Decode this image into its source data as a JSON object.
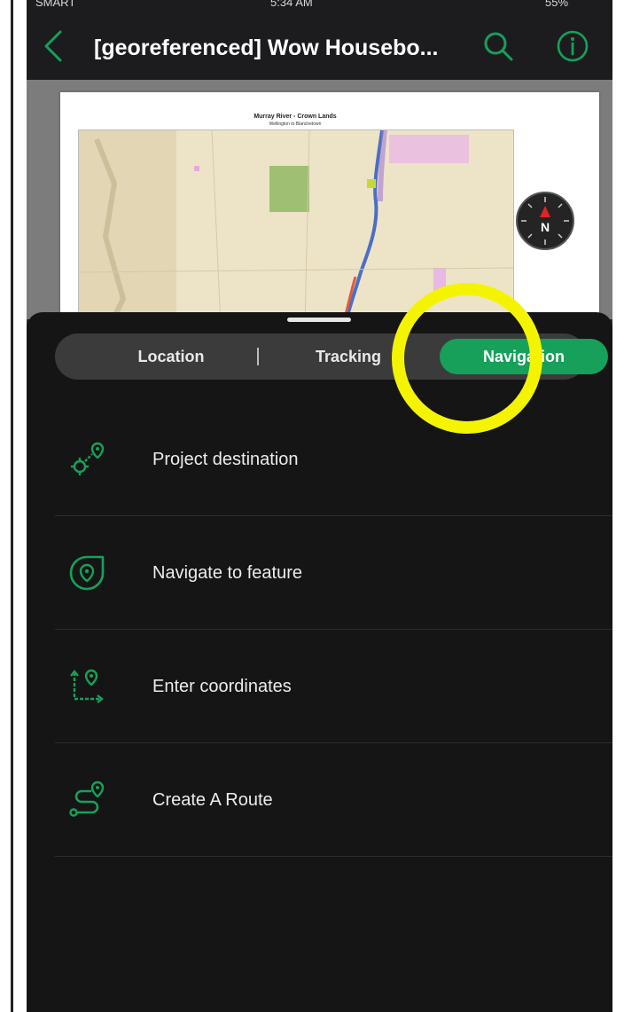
{
  "status_bar": {
    "carrier": "SMART",
    "time": "5:34 AM",
    "battery": "55%"
  },
  "header": {
    "title": "[georeferenced] Wow Housebo...",
    "back_icon": "chevron-left-icon",
    "search_icon": "search-icon",
    "info_icon": "info-icon"
  },
  "map": {
    "title": "Murray River - Crown Lands",
    "subtitle": "Wellington to Blanchetown",
    "compass_label": "N"
  },
  "tabs": {
    "location": "Location",
    "tracking": "Tracking",
    "navigation": "Navigation",
    "selected": "Navigation"
  },
  "menu": [
    {
      "label": "Project destination",
      "icon": "project-destination-icon"
    },
    {
      "label": "Navigate to feature",
      "icon": "navigate-to-feature-icon"
    },
    {
      "label": "Enter coordinates",
      "icon": "enter-coordinates-icon"
    },
    {
      "label": "Create A Route",
      "icon": "create-route-icon"
    }
  ],
  "colors": {
    "accent": "#16a05a",
    "highlight": "#f4f400",
    "sheet_background": "#151515"
  }
}
